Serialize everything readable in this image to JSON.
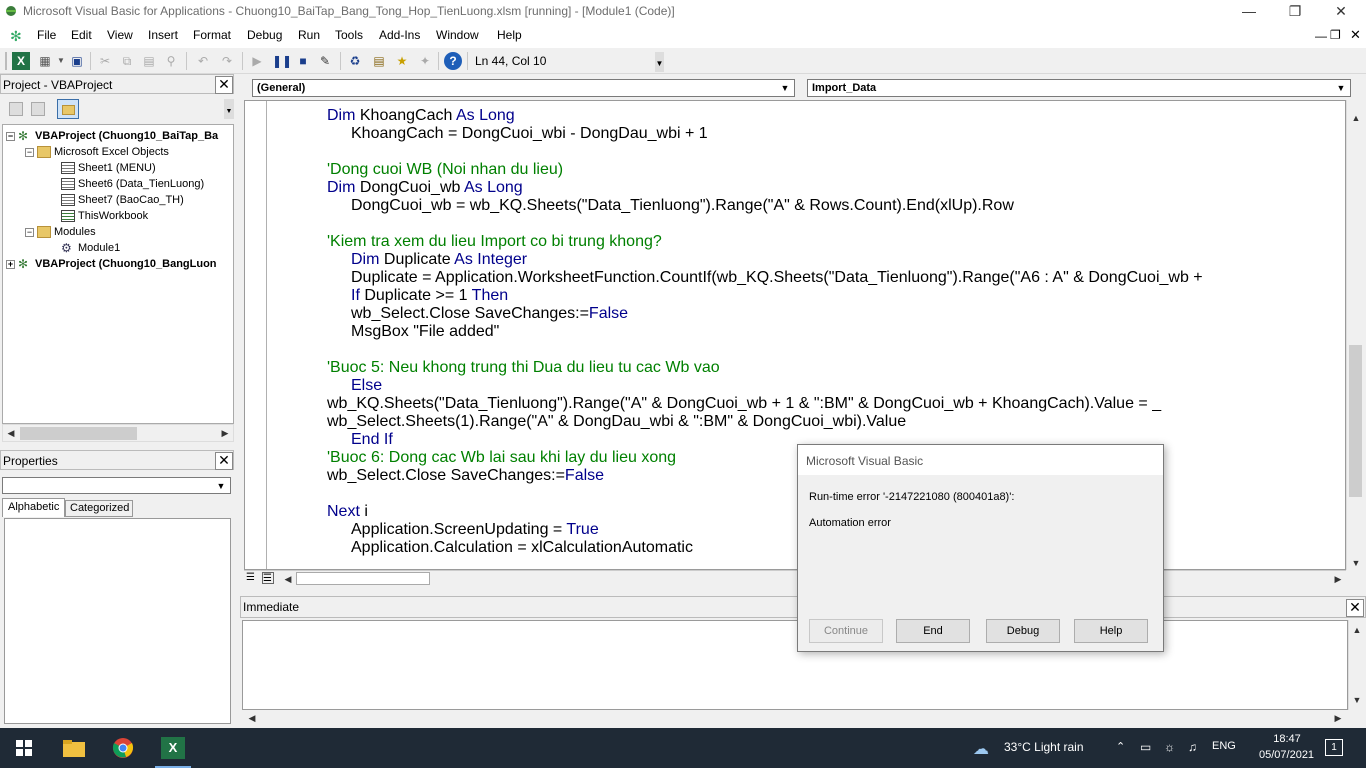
{
  "window": {
    "title": "Microsoft Visual Basic for Applications - Chuong10_BaiTap_Bang_Tong_Hop_TienLuong.xlsm [running] - [Module1 (Code)]"
  },
  "menu": [
    "File",
    "Edit",
    "View",
    "Insert",
    "Format",
    "Debug",
    "Run",
    "Tools",
    "Add-Ins",
    "Window",
    "Help"
  ],
  "toolbar": {
    "position": "Ln 44, Col 10"
  },
  "project": {
    "title": "Project - VBAProject",
    "tree": [
      "VBAProject (Chuong10_BaiTap_Ba",
      "Microsoft Excel Objects",
      "Sheet1 (MENU)",
      "Sheet6 (Data_TienLuong)",
      "Sheet7 (BaoCao_TH)",
      "ThisWorkbook",
      "Modules",
      "Module1",
      "VBAProject (Chuong10_BangLuon"
    ]
  },
  "properties": {
    "title": "Properties",
    "tabs": [
      "Alphabetic",
      "Categorized"
    ]
  },
  "code": {
    "object_dropdown": "(General)",
    "proc_dropdown": "Import_Data",
    "lines": [
      {
        "t": "Dim KhoangCach As Long",
        "indent": 1,
        "type": "dim"
      },
      {
        "t": "KhoangCach = DongCuoi_wbi - DongDau_wbi + 1",
        "indent": 2,
        "type": "plain"
      },
      {
        "t": "",
        "indent": 0,
        "type": "plain"
      },
      {
        "t": "'Dong cuoi WB (Noi nhan du lieu)",
        "indent": 1,
        "type": "comment"
      },
      {
        "t": "Dim DongCuoi_wb As Long",
        "indent": 1,
        "type": "dim"
      },
      {
        "t": "DongCuoi_wb = wb_KQ.Sheets(\"Data_Tienluong\").Range(\"A\" & Rows.Count).End(xlUp).Row",
        "indent": 2,
        "type": "plain"
      },
      {
        "t": "",
        "indent": 0,
        "type": "plain"
      },
      {
        "t": "'Kiem tra xem du lieu Import co bi trung khong?",
        "indent": 1,
        "type": "comment"
      },
      {
        "t": "Dim Duplicate As Integer",
        "indent": 2,
        "type": "dim"
      },
      {
        "t": "Duplicate = Application.WorksheetFunction.CountIf(wb_KQ.Sheets(\"Data_Tienluong\").Range(\"A6 : A\" & DongCuoi_wb +",
        "indent": 2,
        "type": "plain"
      },
      {
        "t": "If Duplicate >= 1 Then",
        "indent": 2,
        "type": "if"
      },
      {
        "t": "wb_Select.Close SaveChanges:=False",
        "indent": 2,
        "type": "false"
      },
      {
        "t": "MsgBox \"File added\"",
        "indent": 2,
        "type": "plain"
      },
      {
        "t": "",
        "indent": 0,
        "type": "plain"
      },
      {
        "t": "'Buoc 5: Neu khong trung thi Dua du lieu tu cac Wb vao",
        "indent": 1,
        "type": "comment"
      },
      {
        "t": "Else",
        "indent": 2,
        "type": "kwonly"
      },
      {
        "t": "wb_KQ.Sheets(\"Data_Tienluong\").Range(\"A\" & DongCuoi_wb + 1 & \":BM\" & DongCuoi_wb + KhoangCach).Value = _",
        "indent": 0,
        "type": "plain"
      },
      {
        "t": "wb_Select.Sheets(1).Range(\"A\" & DongDau_wbi & \":BM\" & DongCuoi_wbi).Value",
        "indent": 0,
        "type": "plain"
      },
      {
        "t": "End If",
        "indent": 2,
        "type": "kwonly"
      },
      {
        "t": "'Buoc 6: Dong cac Wb lai sau khi lay du lieu xong",
        "indent": 1,
        "type": "comment"
      },
      {
        "t": "wb_Select.Close SaveChanges:=False",
        "indent": 1,
        "type": "false"
      },
      {
        "t": "",
        "indent": 0,
        "type": "plain"
      },
      {
        "t": "Next i",
        "indent": 1,
        "type": "next"
      },
      {
        "t": "Application.ScreenUpdating = True",
        "indent": 2,
        "type": "true"
      },
      {
        "t": "Application.Calculation = xlCalculationAutomatic",
        "indent": 2,
        "type": "plain"
      }
    ]
  },
  "immediate": {
    "title": "Immediate"
  },
  "dialog": {
    "title": "Microsoft Visual Basic",
    "error": "Run-time error '-2147221080 (800401a8)':",
    "message": "Automation error",
    "buttons": [
      "Continue",
      "End",
      "Debug",
      "Help"
    ]
  },
  "taskbar": {
    "weather": "33°C  Light rain",
    "lang": "ENG",
    "time": "18:47",
    "date": "05/07/2021"
  }
}
